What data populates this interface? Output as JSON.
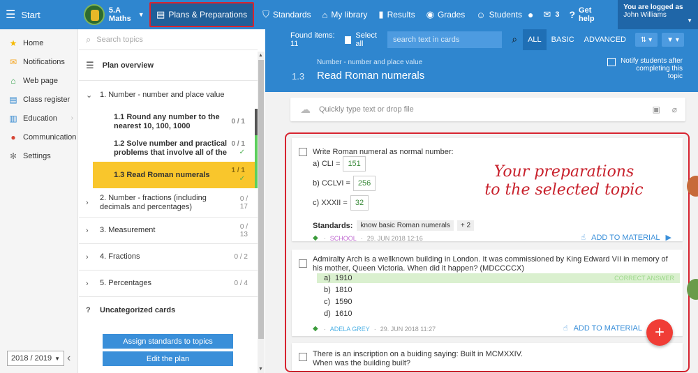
{
  "topbar": {
    "start_label": "Start",
    "class_name": "5.A",
    "class_subject": "Maths",
    "nav": [
      {
        "label": "Plans & Preparations",
        "icon": "briefcase-icon",
        "active": true
      },
      {
        "label": "Standards",
        "icon": "shield-icon",
        "active": false
      },
      {
        "label": "My library",
        "icon": "library-icon",
        "active": false
      },
      {
        "label": "Results",
        "icon": "bar-chart-icon",
        "active": false
      },
      {
        "label": "Grades",
        "icon": "grades-icon",
        "active": false
      },
      {
        "label": "Students",
        "icon": "students-icon",
        "active": false
      }
    ],
    "messages_count": "3",
    "help_label": "Get help",
    "logged_label": "You are logged as",
    "user_name": "John Williams"
  },
  "left_nav": {
    "items": [
      {
        "label": "Home",
        "icon": "star-icon",
        "color": "#f5b800"
      },
      {
        "label": "Notifications",
        "icon": "envelope-icon",
        "color": "#f5a623"
      },
      {
        "label": "Web page",
        "icon": "house-icon",
        "color": "#2e9e45"
      },
      {
        "label": "Class register",
        "icon": "register-icon",
        "color": "#2f86cf"
      },
      {
        "label": "Education",
        "icon": "book-icon",
        "color": "#2f86cf"
      },
      {
        "label": "Communication",
        "icon": "chat-icon",
        "color": "#d64535"
      },
      {
        "label": "Settings",
        "icon": "gear-icon",
        "color": "#7a7a7a"
      }
    ],
    "year": "2018 / 2019"
  },
  "topics": {
    "search_placeholder": "Search topics",
    "overview": "Plan overview",
    "t1": {
      "title": "1. Number - number and place value"
    },
    "subs": [
      {
        "title": "1.1 Round any number to the nearest 10, 100, 1000",
        "count": "0 / 1"
      },
      {
        "title": "1.2 Solve number and practical problems that involve all of the",
        "count": "0 / 1"
      },
      {
        "title": "1.3 Read Roman numerals",
        "count": "1 / 1"
      }
    ],
    "t2": {
      "title": "2. Number - fractions (including decimals and percentages)",
      "count": "0 / 17"
    },
    "t3": {
      "title": "3. Measurement",
      "count": "0 / 13"
    },
    "t4": {
      "title": "4. Fractions",
      "count": "0 / 2"
    },
    "t5": {
      "title": "5. Percentages",
      "count": "0 / 4"
    },
    "uncat_mark": "?",
    "uncat": "Uncategorized cards",
    "assign_btn": "Assign standards to topics",
    "edit_btn": "Edit the plan"
  },
  "main": {
    "found": "Found items: 11",
    "select_all": "Select all",
    "search_placeholder": "search text in cards",
    "levels": [
      "ALL",
      "BASIC",
      "ADVANCED"
    ],
    "crumb": "Number - number and place value",
    "num": "1.3",
    "title": "Read Roman numerals",
    "notify": "Notify students after completing this topic",
    "drop_placeholder": "Quickly type text or drop file"
  },
  "card1": {
    "question": "Write Roman numeral as normal number:",
    "rows": [
      {
        "label": "a) CLI =",
        "value": "151"
      },
      {
        "label": "b) CCLVI =",
        "value": "256"
      },
      {
        "label": "c) XXXII =",
        "value": "32"
      }
    ],
    "standards_label": "Standards:",
    "standard": "know basic Roman numerals",
    "more": "+ 2",
    "author": "SCHOOL",
    "date": "29. JUN 2018 12:16",
    "add": "ADD TO MATERIAL"
  },
  "card2": {
    "question": "Admiralty Arch is a wellknown building in London. It was commissioned by King Edward VII in memory of his mother, Queen Victoria. When did it happen? (MDCCCCX)",
    "options": [
      {
        "letter": "a)",
        "text": "1910"
      },
      {
        "letter": "b)",
        "text": "1810"
      },
      {
        "letter": "c)",
        "text": "1590"
      },
      {
        "letter": "d)",
        "text": "1610"
      }
    ],
    "correct_label": "CORRECT ANSWER",
    "author": "ADELA GREY",
    "date": "29. JUN 2018 11:27",
    "add": "ADD TO MATERIAL"
  },
  "card3": {
    "line1": "There is an inscription on a buiding saying: Built in MCMXXIV.",
    "line2": "When was the building built?"
  },
  "annotation": {
    "line1": "Your preparations",
    "line2": "to the selected topic"
  },
  "colors": {
    "topbar": "#2f86cf",
    "accent_red": "#d72430",
    "active_topic": "#f9c62c"
  }
}
